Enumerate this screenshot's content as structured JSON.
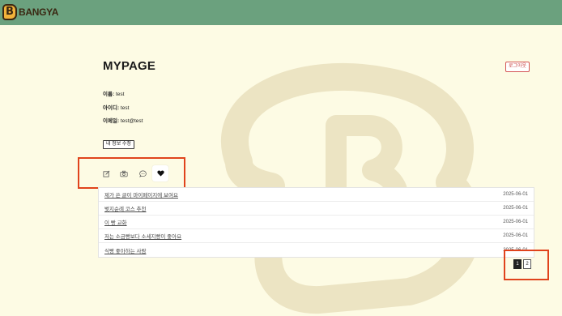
{
  "header": {
    "logo_letter": "B",
    "logo_text": "BANGYA",
    "bg_color": "#6ba17e"
  },
  "page": {
    "title": "MYPAGE",
    "logout_label": "로그아웃"
  },
  "profile": {
    "name_label": "이름:",
    "name_value": "test",
    "id_label": "아이디:",
    "id_value": "test",
    "email_label": "이메일:",
    "email_value": "test@test",
    "edit_button": "내 정보 수정"
  },
  "tabs": [
    {
      "icon": "pencil-square-icon",
      "active": false
    },
    {
      "icon": "camera-icon",
      "active": false
    },
    {
      "icon": "chat-bubble-icon",
      "active": false
    },
    {
      "icon": "heart-icon",
      "active": true
    }
  ],
  "posts": [
    {
      "title": "제가 쓴 글이 마이페이지에 보여요",
      "date": "2025-06-01"
    },
    {
      "title": "벚지순례 코스 추천",
      "date": "2025-06-01"
    },
    {
      "title": "이 빵 교화",
      "date": "2025-06-01"
    },
    {
      "title": "저는 소금빵보다 소세지빵이 좋아요",
      "date": "2025-06-01"
    },
    {
      "title": "식빵 좋아하는 사람",
      "date": "2025-06-01"
    }
  ],
  "pagination": {
    "pages": [
      "1",
      "2"
    ],
    "current": "1"
  },
  "colors": {
    "background": "#fdfbe4",
    "highlight_box": "#e0431c",
    "logout": "#c63b3b"
  }
}
